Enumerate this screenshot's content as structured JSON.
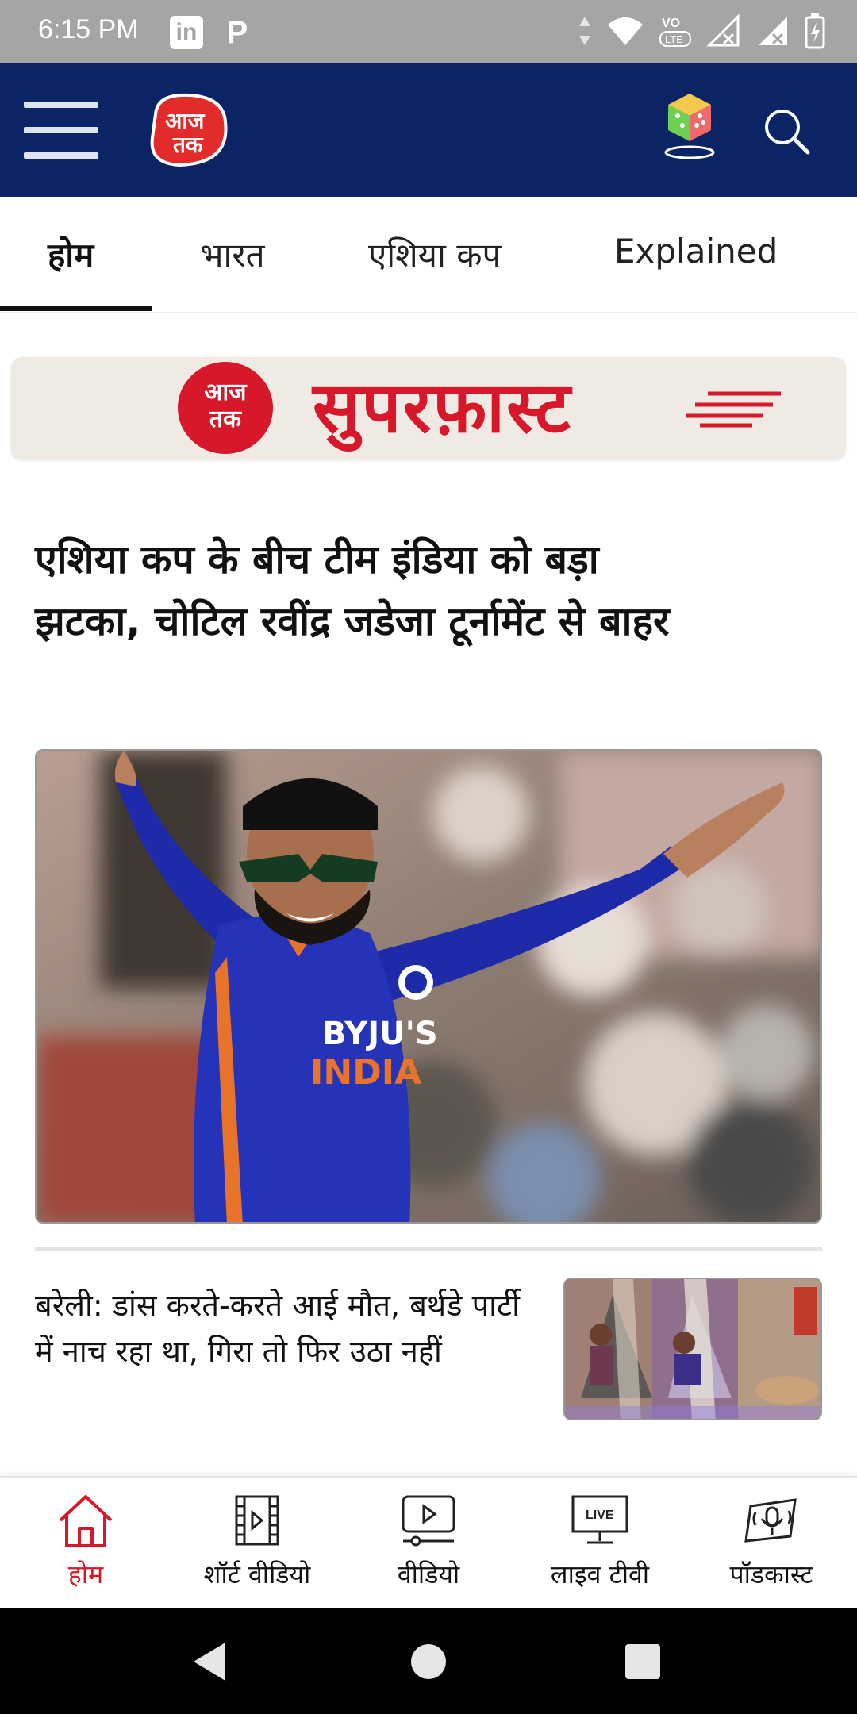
{
  "status_bar": {
    "time": "6:15 PM",
    "left_icons": [
      "linkedin-icon",
      "p-icon"
    ],
    "right_icons": [
      "data-arrows-icon",
      "wifi-icon",
      "volte-icon",
      "signal-1-icon",
      "signal-2-icon",
      "battery-icon"
    ]
  },
  "header": {
    "logo_text": "आज तक",
    "brand_color": "#0b2466",
    "accent_color": "#d7182a"
  },
  "tabs": [
    {
      "label": "होम",
      "active": true
    },
    {
      "label": "भारत",
      "active": false
    },
    {
      "label": "एशिया कप",
      "active": false
    },
    {
      "label": "Explained",
      "active": false
    }
  ],
  "banner": {
    "logo_line1": "आज",
    "logo_line2": "तक",
    "title": "सुपरफ़ास्ट"
  },
  "headline": {
    "text": "एशिया कप के बीच टीम इंडिया को बड़ा झटका, चोटिल रवींद्र जडेजा टूर्नामेंट से बाहर"
  },
  "main_image": {
    "jersey_text": "INDIA",
    "sponsor_text": "BYJU'S"
  },
  "story": {
    "title": "बरेली: डांस करते-करते आई मौत, बर्थडे पार्टी में नाच रहा था, गिरा तो फिर उठा नहीं"
  },
  "bottom_nav": [
    {
      "label": "होम",
      "icon": "home-icon",
      "active": true
    },
    {
      "label": "शॉर्ट वीडियो",
      "icon": "short-video-icon",
      "active": false
    },
    {
      "label": "वीडियो",
      "icon": "video-icon",
      "active": false
    },
    {
      "label": "लाइव टीवी",
      "icon": "live-tv-icon",
      "active": false,
      "badge": "LIVE"
    },
    {
      "label": "पॉडकास्ट",
      "icon": "podcast-icon",
      "active": false
    }
  ]
}
